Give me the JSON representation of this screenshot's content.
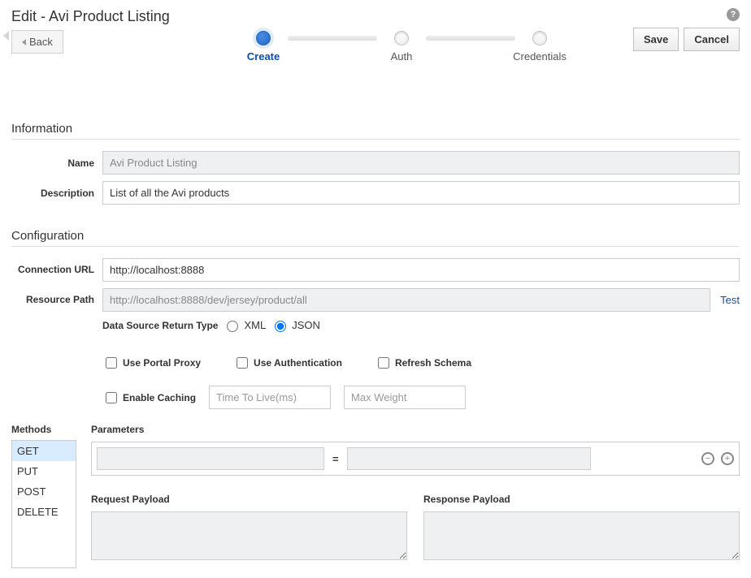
{
  "header": {
    "title": "Edit - Avi Product Listing",
    "back_label": "Back",
    "help_glyph": "?"
  },
  "steps": [
    {
      "label": "Create",
      "active": true
    },
    {
      "label": "Auth",
      "active": false
    },
    {
      "label": "Credentials",
      "active": false
    }
  ],
  "actions": {
    "save_label": "Save",
    "cancel_label": "Cancel"
  },
  "information": {
    "section_title": "Information",
    "name_label": "Name",
    "name_value": "Avi Product Listing",
    "description_label": "Description",
    "description_value": "List of all the Avi products"
  },
  "configuration": {
    "section_title": "Configuration",
    "connection_url_label": "Connection URL",
    "connection_url_value": "http://localhost:8888",
    "resource_path_label": "Resource Path",
    "resource_path_value": "http://localhost:8888/dev/jersey/product/all",
    "test_label": "Test",
    "return_type_label": "Data Source Return Type",
    "return_type_options": {
      "xml": "XML",
      "json": "JSON"
    },
    "return_type_selected": "json",
    "use_portal_proxy_label": "Use Portal Proxy",
    "use_authentication_label": "Use Authentication",
    "refresh_schema_label": "Refresh Schema",
    "enable_caching_label": "Enable Caching",
    "ttl_placeholder": "Time To Live(ms)",
    "ttl_value": "",
    "max_weight_placeholder": "Max Weight",
    "max_weight_value": ""
  },
  "methods": {
    "header": "Methods",
    "items": [
      "GET",
      "PUT",
      "POST",
      "DELETE"
    ],
    "selected": "GET"
  },
  "parameters": {
    "header": "Parameters",
    "key": "",
    "value": "",
    "equals_glyph": "=",
    "remove_glyph": "−",
    "add_glyph": "+"
  },
  "payloads": {
    "request_label": "Request Payload",
    "request_value": "",
    "response_label": "Response Payload",
    "response_value": ""
  }
}
